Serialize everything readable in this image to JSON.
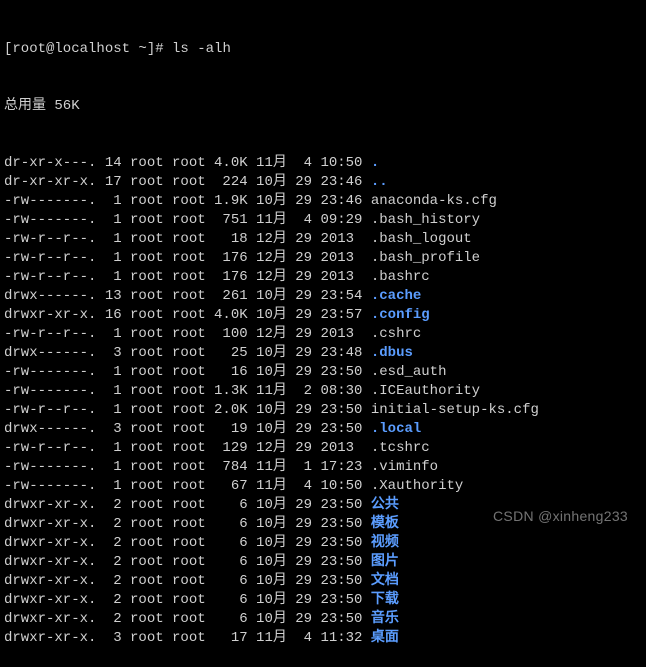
{
  "prompt": {
    "user": "root",
    "host": "localhost",
    "path": "~",
    "symbol": "#",
    "command": "ls -alh"
  },
  "summary": "总用量 56K",
  "rows": [
    {
      "perm": "dr-xr-x---.",
      "links": "14",
      "owner": "root",
      "group": "root",
      "size": "4.0K",
      "month": "11月",
      "day": "4",
      "time": "10:50",
      "name": ".",
      "color": "blue"
    },
    {
      "perm": "dr-xr-xr-x.",
      "links": "17",
      "owner": "root",
      "group": "root",
      "size": "224",
      "month": "10月",
      "day": "29",
      "time": "23:46",
      "name": "..",
      "color": "blue"
    },
    {
      "perm": "-rw-------.",
      "links": "1",
      "owner": "root",
      "group": "root",
      "size": "1.9K",
      "month": "10月",
      "day": "29",
      "time": "23:46",
      "name": "anaconda-ks.cfg",
      "color": "plain"
    },
    {
      "perm": "-rw-------.",
      "links": "1",
      "owner": "root",
      "group": "root",
      "size": "751",
      "month": "11月",
      "day": "4",
      "time": "09:29",
      "name": ".bash_history",
      "color": "plain"
    },
    {
      "perm": "-rw-r--r--.",
      "links": "1",
      "owner": "root",
      "group": "root",
      "size": "18",
      "month": "12月",
      "day": "29",
      "time": "2013",
      "name": ".bash_logout",
      "color": "plain"
    },
    {
      "perm": "-rw-r--r--.",
      "links": "1",
      "owner": "root",
      "group": "root",
      "size": "176",
      "month": "12月",
      "day": "29",
      "time": "2013",
      "name": ".bash_profile",
      "color": "plain"
    },
    {
      "perm": "-rw-r--r--.",
      "links": "1",
      "owner": "root",
      "group": "root",
      "size": "176",
      "month": "12月",
      "day": "29",
      "time": "2013",
      "name": ".bashrc",
      "color": "plain"
    },
    {
      "perm": "drwx------.",
      "links": "13",
      "owner": "root",
      "group": "root",
      "size": "261",
      "month": "10月",
      "day": "29",
      "time": "23:54",
      "name": ".cache",
      "color": "blue"
    },
    {
      "perm": "drwxr-xr-x.",
      "links": "16",
      "owner": "root",
      "group": "root",
      "size": "4.0K",
      "month": "10月",
      "day": "29",
      "time": "23:57",
      "name": ".config",
      "color": "blue"
    },
    {
      "perm": "-rw-r--r--.",
      "links": "1",
      "owner": "root",
      "group": "root",
      "size": "100",
      "month": "12月",
      "day": "29",
      "time": "2013",
      "name": ".cshrc",
      "color": "plain"
    },
    {
      "perm": "drwx------.",
      "links": "3",
      "owner": "root",
      "group": "root",
      "size": "25",
      "month": "10月",
      "day": "29",
      "time": "23:48",
      "name": ".dbus",
      "color": "blue"
    },
    {
      "perm": "-rw-------.",
      "links": "1",
      "owner": "root",
      "group": "root",
      "size": "16",
      "month": "10月",
      "day": "29",
      "time": "23:50",
      "name": ".esd_auth",
      "color": "plain"
    },
    {
      "perm": "-rw-------.",
      "links": "1",
      "owner": "root",
      "group": "root",
      "size": "1.3K",
      "month": "11月",
      "day": "2",
      "time": "08:30",
      "name": ".ICEauthority",
      "color": "plain"
    },
    {
      "perm": "-rw-r--r--.",
      "links": "1",
      "owner": "root",
      "group": "root",
      "size": "2.0K",
      "month": "10月",
      "day": "29",
      "time": "23:50",
      "name": "initial-setup-ks.cfg",
      "color": "plain"
    },
    {
      "perm": "drwx------.",
      "links": "3",
      "owner": "root",
      "group": "root",
      "size": "19",
      "month": "10月",
      "day": "29",
      "time": "23:50",
      "name": ".local",
      "color": "blue"
    },
    {
      "perm": "-rw-r--r--.",
      "links": "1",
      "owner": "root",
      "group": "root",
      "size": "129",
      "month": "12月",
      "day": "29",
      "time": "2013",
      "name": ".tcshrc",
      "color": "plain"
    },
    {
      "perm": "-rw-------.",
      "links": "1",
      "owner": "root",
      "group": "root",
      "size": "784",
      "month": "11月",
      "day": "1",
      "time": "17:23",
      "name": ".viminfo",
      "color": "plain"
    },
    {
      "perm": "-rw-------.",
      "links": "1",
      "owner": "root",
      "group": "root",
      "size": "67",
      "month": "11月",
      "day": "4",
      "time": "10:50",
      "name": ".Xauthority",
      "color": "plain"
    },
    {
      "perm": "drwxr-xr-x.",
      "links": "2",
      "owner": "root",
      "group": "root",
      "size": "6",
      "month": "10月",
      "day": "29",
      "time": "23:50",
      "name": "公共",
      "color": "blue"
    },
    {
      "perm": "drwxr-xr-x.",
      "links": "2",
      "owner": "root",
      "group": "root",
      "size": "6",
      "month": "10月",
      "day": "29",
      "time": "23:50",
      "name": "模板",
      "color": "blue"
    },
    {
      "perm": "drwxr-xr-x.",
      "links": "2",
      "owner": "root",
      "group": "root",
      "size": "6",
      "month": "10月",
      "day": "29",
      "time": "23:50",
      "name": "视频",
      "color": "blue"
    },
    {
      "perm": "drwxr-xr-x.",
      "links": "2",
      "owner": "root",
      "group": "root",
      "size": "6",
      "month": "10月",
      "day": "29",
      "time": "23:50",
      "name": "图片",
      "color": "blue"
    },
    {
      "perm": "drwxr-xr-x.",
      "links": "2",
      "owner": "root",
      "group": "root",
      "size": "6",
      "month": "10月",
      "day": "29",
      "time": "23:50",
      "name": "文档",
      "color": "blue"
    },
    {
      "perm": "drwxr-xr-x.",
      "links": "2",
      "owner": "root",
      "group": "root",
      "size": "6",
      "month": "10月",
      "day": "29",
      "time": "23:50",
      "name": "下载",
      "color": "blue"
    },
    {
      "perm": "drwxr-xr-x.",
      "links": "2",
      "owner": "root",
      "group": "root",
      "size": "6",
      "month": "10月",
      "day": "29",
      "time": "23:50",
      "name": "音乐",
      "color": "blue"
    },
    {
      "perm": "drwxr-xr-x.",
      "links": "3",
      "owner": "root",
      "group": "root",
      "size": "17",
      "month": "11月",
      "day": "4",
      "time": "11:32",
      "name": "桌面",
      "color": "blue"
    }
  ],
  "watermark": "CSDN @xinheng233"
}
